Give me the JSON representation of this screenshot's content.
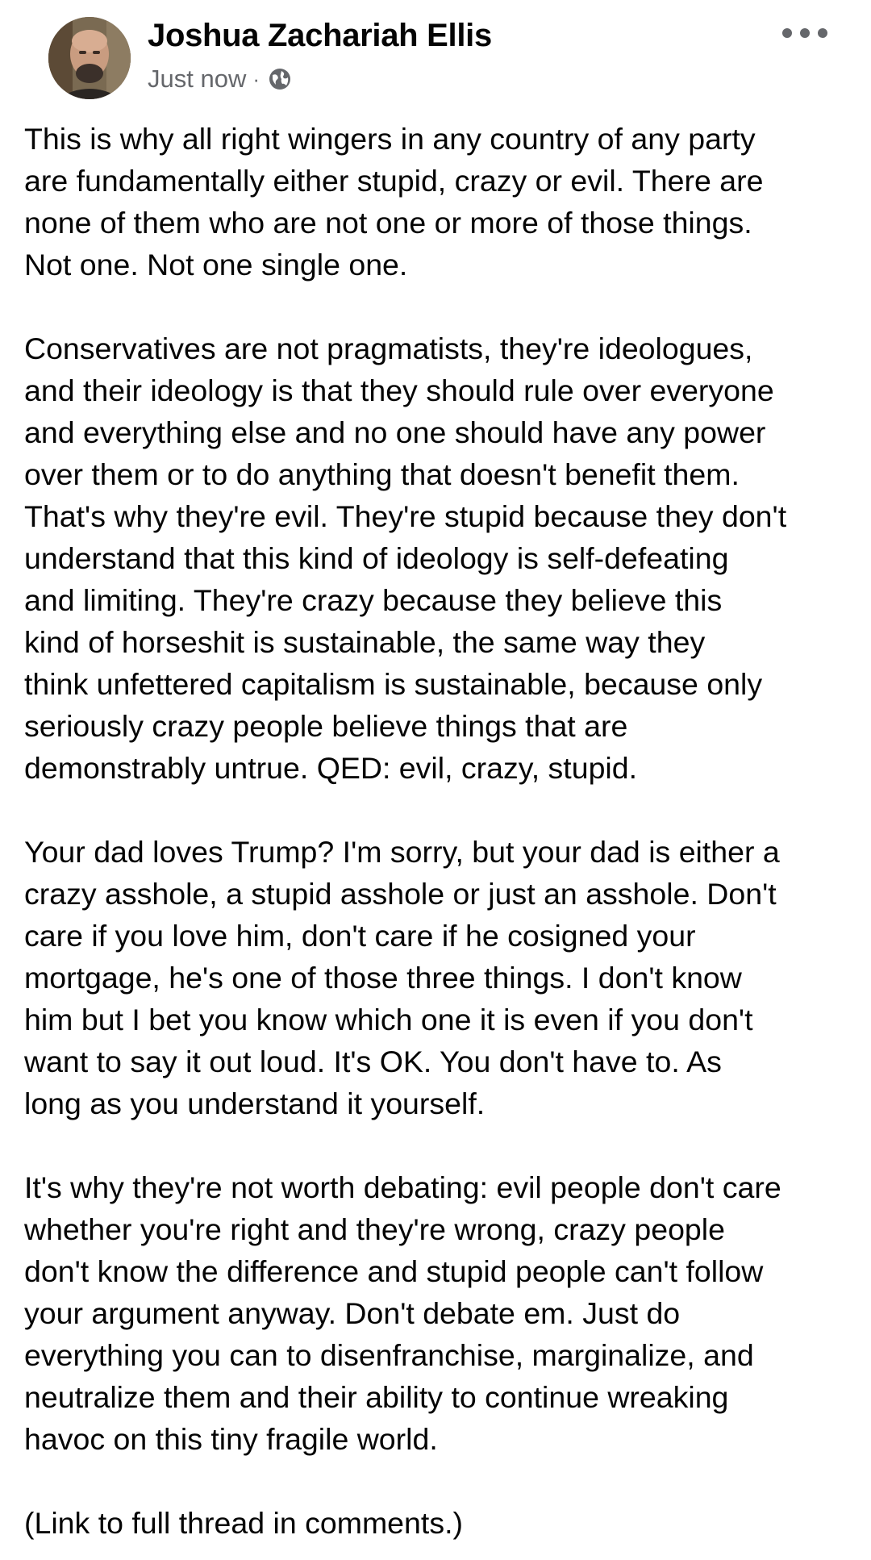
{
  "post": {
    "author": "Joshua Zachariah Ellis",
    "timestamp": "Just now",
    "separator": "·",
    "privacy_icon": "globe-icon",
    "more_icon": "more-horizontal-icon",
    "paragraphs": [
      "This is why all right wingers in any country of any party\nare fundamentally either stupid, crazy or evil. There are\nnone of them who are not one or more of those things.\nNot one. Not one single one.",
      "Conservatives are not pragmatists, they're ideologues,\nand their ideology is that they should rule over everyone\nand everything else and no one should have any power\nover them or to do anything that doesn't benefit them.\nThat's why they're evil. They're stupid because they don't\nunderstand that this kind of ideology is self-defeating\nand limiting. They're crazy because they believe this\nkind of horseshit is sustainable, the same way they\nthink unfettered capitalism is sustainable, because only\nseriously crazy people believe things that are\ndemonstrably untrue. QED: evil, crazy, stupid.",
      "Your dad loves Trump? I'm sorry, but your dad is either a\ncrazy asshole, a stupid asshole or just an asshole. Don't\ncare if you love him, don't care if he cosigned your\nmortgage, he's one of those three things. I don't know\nhim but I bet you know which one it is even if you don't\nwant to say it out loud. It's OK. You don't have to. As\nlong as you understand it yourself.",
      "It's why they're not worth debating: evil people don't care\nwhether you're right and they're wrong, crazy people\ndon't know the difference and stupid people can't follow\nyour argument anyway. Don't debate em. Just do\neverything you can to disenfranchise, marginalize, and\nneutralize them and their ability to continue wreaking\nhavoc on this tiny fragile world.",
      "(Link to full thread in comments.)"
    ]
  },
  "colors": {
    "text": "#050505",
    "secondary_text": "#65676b",
    "background": "#ffffff"
  }
}
